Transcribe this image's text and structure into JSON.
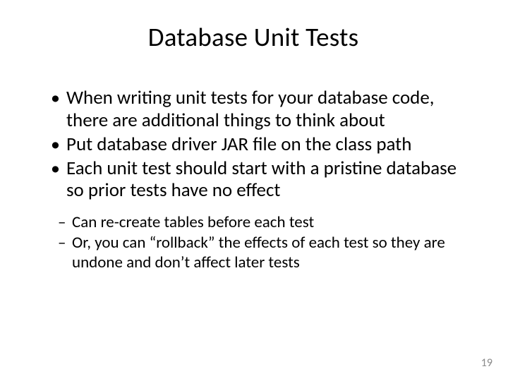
{
  "title": "Database Unit Tests",
  "bullets": [
    "When writing unit tests for your database code, there are additional things to think about",
    "Put database driver JAR file on the class path",
    "Each unit test should start with a pristine database so prior tests have no effect"
  ],
  "sub": [
    "Can re-create tables before each test",
    "Or, you can “rollback” the effects of each test so they are undone and don’t affect later tests"
  ],
  "page": "19"
}
